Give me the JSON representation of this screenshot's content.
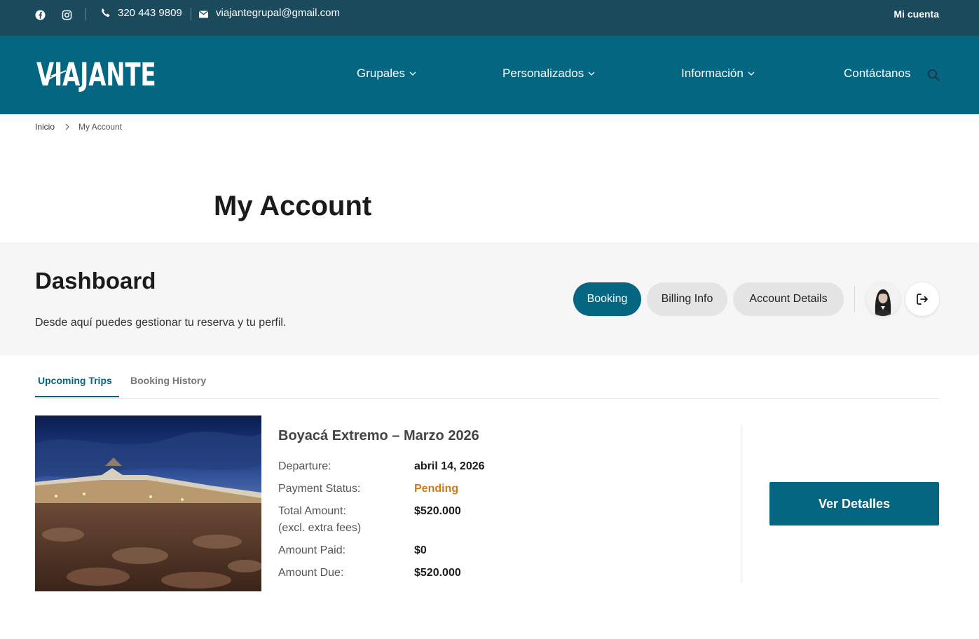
{
  "topbar": {
    "phone": "320 443 9809",
    "email": "viajantegrupal@gmail.com",
    "account_link": "Mi cuenta",
    "icons": [
      "facebook-icon",
      "instagram-icon",
      "phone-icon",
      "mail-icon"
    ]
  },
  "nav": {
    "logo": "VIAJANTE",
    "items": [
      {
        "label": "Grupales",
        "has_dropdown": true
      },
      {
        "label": "Personalizados",
        "has_dropdown": true
      },
      {
        "label": "Información",
        "has_dropdown": true
      },
      {
        "label": "Contáctanos",
        "has_dropdown": false
      }
    ]
  },
  "breadcrumb": {
    "home": "Inicio",
    "current": "My Account"
  },
  "page": {
    "title": "My Account"
  },
  "dashboard": {
    "title": "Dashboard",
    "subtitle": "Desde aquí puedes gestionar tu reserva y tu perfil.",
    "pills": [
      {
        "label": "Booking",
        "active": true
      },
      {
        "label": "Billing Info",
        "active": false
      },
      {
        "label": "Account Details",
        "active": false
      }
    ]
  },
  "tabs": {
    "upcoming": "Upcoming Trips",
    "history": "Booking History"
  },
  "trip": {
    "title": "Boyacá Extremo – Marzo 2026",
    "departure_label": "Departure:",
    "departure_value": "abril 14, 2026",
    "payment_status_label": "Payment Status:",
    "payment_status_value": "Pending",
    "total_label_1": "Total Amount:",
    "total_label_2": "(excl. extra fees)",
    "total_value": "$520.000",
    "paid_label": "Amount Paid:",
    "paid_value": "$0",
    "due_label": "Amount Due:",
    "due_value": "$520.000",
    "button": "Ver Detalles"
  },
  "colors": {
    "topbar": "#1a4a5c",
    "nav": "#046681",
    "accent": "#046681",
    "pending": "#d07a12",
    "panel": "#f6f6f6"
  }
}
